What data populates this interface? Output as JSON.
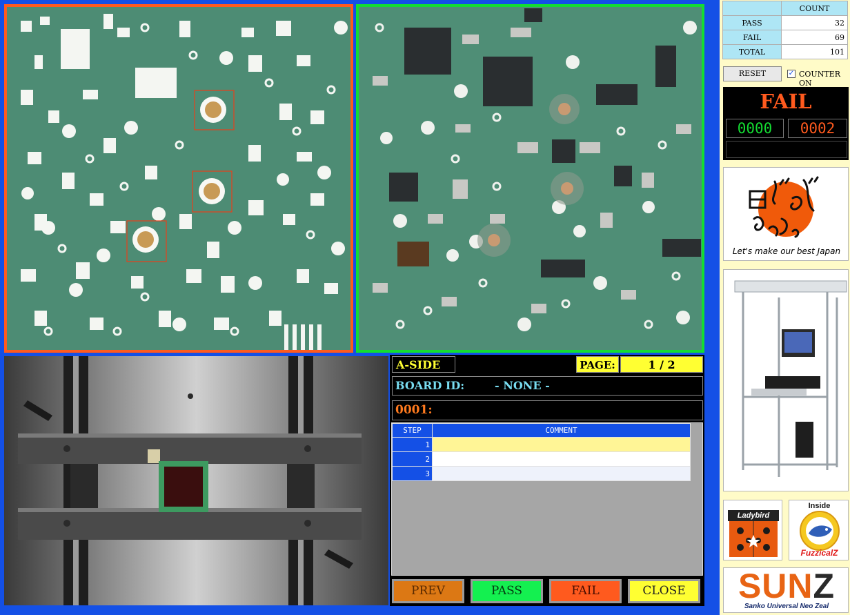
{
  "colors": {
    "background": "#1450e6",
    "pane_left_border": "#ff5a1e",
    "pane_right_border": "#14dc32",
    "pass": "#14dc32",
    "fail": "#ff5a1e",
    "yellow": "#ffff32"
  },
  "panes": {
    "left": "pcb-reference-image",
    "right": "pcb-inspection-image",
    "bottom": "fixture-camera-image"
  },
  "info": {
    "side": "A-SIDE",
    "page_label": "PAGE:",
    "page_value": "1 / 2",
    "board_id_label": "BOARD ID:",
    "board_id_value": "- NONE -",
    "serial": "0001:"
  },
  "grid": {
    "headers": [
      "STEP",
      "COMMENT"
    ],
    "rows": [
      {
        "step": "1",
        "comment": ""
      },
      {
        "step": "2",
        "comment": ""
      },
      {
        "step": "3",
        "comment": ""
      }
    ]
  },
  "buttons": {
    "prev": "PREV",
    "pass": "PASS",
    "fail": "FAIL",
    "close": "CLOSE"
  },
  "counter": {
    "header": "COUNT",
    "rows": [
      {
        "label": "PASS",
        "value": "32"
      },
      {
        "label": "FAIL",
        "value": "69"
      },
      {
        "label": "TOTAL",
        "value": "101"
      }
    ],
    "reset_label": "RESET",
    "counter_on_label": "COUNTER ON",
    "counter_on_checked": true
  },
  "result": {
    "status": "FAIL",
    "pass_count": "0000",
    "fail_count": "0002",
    "message": ""
  },
  "logos": {
    "ganbaro_tagline": "Let's make our best Japan",
    "ladybird": "Ladybird",
    "fuzzical_top": "Inside",
    "fuzzical": "FuzzicalZ",
    "sunz_main": "SUN",
    "sunz_z": "Z",
    "sunz_sub": "Sanko Universal Neo Zeal"
  }
}
